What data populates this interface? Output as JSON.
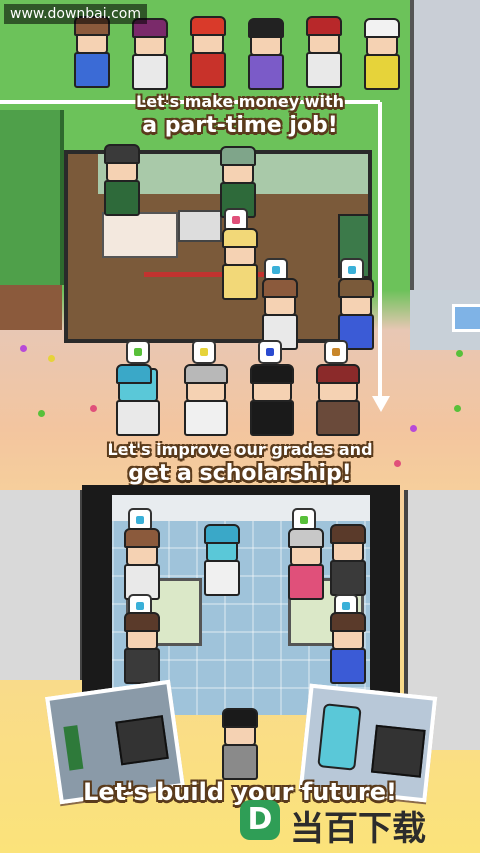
{
  "watermark": {
    "text": "www.downbai.com"
  },
  "banners": {
    "part_time_line1": "Let's make money with",
    "part_time_line2": "a part-time job!",
    "grades_line1": "Let's improve our grades and",
    "grades_line2": "get a scholarship!",
    "future": "Let's build your future!"
  },
  "logo": {
    "mark": "D",
    "text": "当百下载"
  },
  "colors": {
    "grass": "#6cc25a",
    "room_wood": "#7b5a3a",
    "classroom_floor": "#9fc3da",
    "banner_outline": "#5a3b1c",
    "logo_green": "#2f9e56"
  },
  "icons": {
    "heart": "heart-icon",
    "diamond": "diamond-icon",
    "book": "book-icon",
    "pen": "pen-icon"
  }
}
